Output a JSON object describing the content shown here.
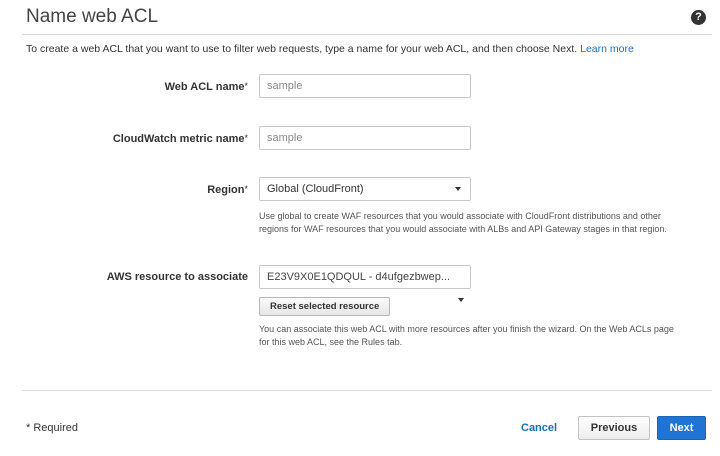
{
  "header": {
    "title": "Name web ACL",
    "help_glyph": "?",
    "intro": "To create a web ACL that you want to use to filter web requests, type a name for your web ACL, and then choose Next.",
    "learn_more": "Learn more"
  },
  "form": {
    "web_acl_name": {
      "label": "Web ACL name",
      "required_mark": "*",
      "value": "sample"
    },
    "metric_name": {
      "label": "CloudWatch metric name",
      "required_mark": "*",
      "value": "sample"
    },
    "region": {
      "label": "Region",
      "required_mark": "*",
      "selected": "Global (CloudFront)",
      "hint": "Use global to create WAF resources that you would associate with CloudFront distributions and other regions for WAF resources that you would associate with ALBs and API Gateway stages in that region."
    },
    "resource": {
      "label": "AWS resource to associate",
      "value": "E23V9X0E1QDQUL - d4ufgezbwep...",
      "reset_label": "Reset selected resource",
      "hint": "You can associate this web ACL with more resources after you finish the wizard. On the Web ACLs page for this web ACL, see the Rules tab."
    }
  },
  "footer": {
    "required_note": "* Required",
    "cancel": "Cancel",
    "previous": "Previous",
    "next": "Next"
  },
  "colors": {
    "link": "#1f6fb5",
    "primary_button": "#1f74d3"
  }
}
